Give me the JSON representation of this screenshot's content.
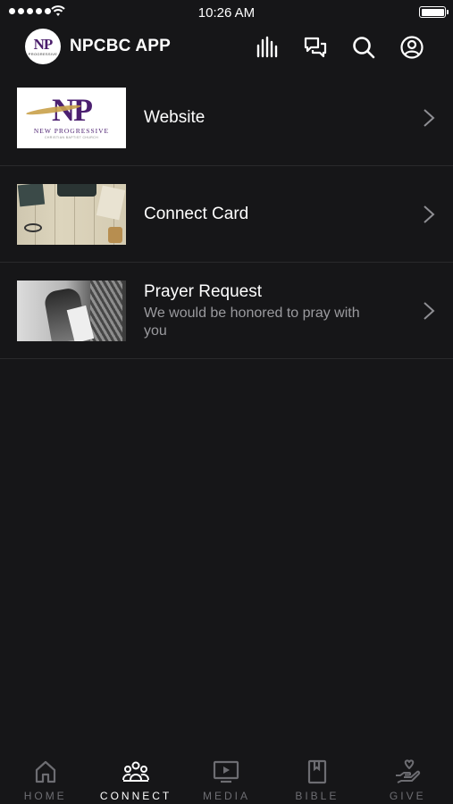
{
  "status_bar": {
    "time": "10:26 AM",
    "battery_level": 1.0
  },
  "header": {
    "title": "NPCBC APP",
    "logo_text": "NP",
    "logo_subtext": "PROGRESSIVE",
    "icons": [
      "equalizer-icon",
      "chat-icon",
      "search-icon",
      "profile-icon"
    ]
  },
  "list": {
    "items": [
      {
        "title": "Website",
        "subtitle": ""
      },
      {
        "title": "Connect Card",
        "subtitle": ""
      },
      {
        "title": "Prayer Request",
        "subtitle": "We would be honored to pray with you"
      }
    ],
    "website_thumb": {
      "logo": "NP",
      "brand": "NEW PROGRESSIVE",
      "tagline": "CHRISTIAN BAPTIST CHURCH"
    }
  },
  "tabs": [
    {
      "label": "HOME",
      "icon": "home-icon",
      "active": false
    },
    {
      "label": "CONNECT",
      "icon": "people-icon",
      "active": true
    },
    {
      "label": "MEDIA",
      "icon": "tv-play-icon",
      "active": false
    },
    {
      "label": "BIBLE",
      "icon": "book-icon",
      "active": false
    },
    {
      "label": "GIVE",
      "icon": "heart-hand-icon",
      "active": false
    }
  ],
  "colors": {
    "background": "#161618",
    "divider": "#2a2a2c",
    "text_primary": "#ffffff",
    "text_secondary": "#9a9a9e",
    "tab_inactive": "#6d6d72"
  }
}
